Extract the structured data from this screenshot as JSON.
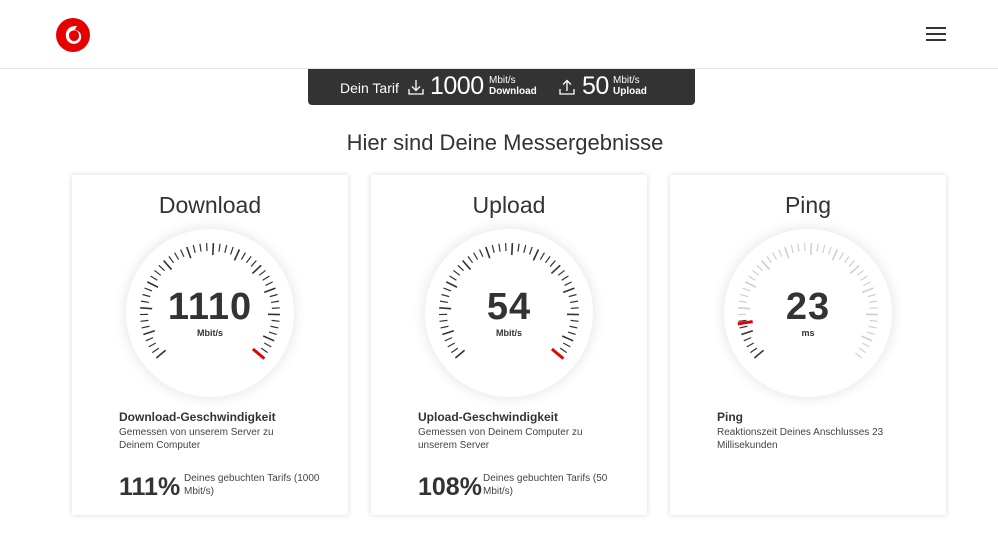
{
  "brand": {
    "color": "#e60000"
  },
  "header": {
    "logo_icon": "vodafone-logo-icon",
    "menu_icon": "hamburger-menu-icon"
  },
  "tarif": {
    "label": "Dein Tarif",
    "download_value": "1000",
    "download_unit": "Mbit/s",
    "download_label": "Download",
    "upload_value": "50",
    "upload_unit": "Mbit/s",
    "upload_label": "Upload"
  },
  "headline": "Hier sind Deine Messergebnisse",
  "cards": [
    {
      "title": "Download",
      "value": "1110",
      "unit": "Mbit/s",
      "level": 1.0,
      "desc_title": "Download-Geschwindigkeit",
      "desc_text": "Gemessen von unserem Server zu Deinem Computer",
      "percent": "111%",
      "percent_text": "Deines gebuchten Tarifs (1000 Mbit/s)"
    },
    {
      "title": "Upload",
      "value": "54",
      "unit": "Mbit/s",
      "level": 1.0,
      "desc_title": "Upload-Geschwindigkeit",
      "desc_text": "Gemessen von Deinem Computer zu unserem Server",
      "percent": "108%",
      "percent_text": "Deines gebuchten Tarifs (50 Mbit/s)"
    },
    {
      "title": "Ping",
      "value": "23",
      "unit": "ms",
      "level": 0.12,
      "desc_title": "Ping",
      "desc_text": "Reaktionszeit Deines Anschlusses 23 Millisekunden"
    }
  ]
}
